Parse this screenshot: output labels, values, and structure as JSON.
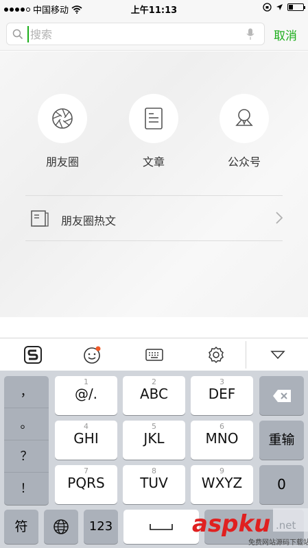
{
  "status_bar": {
    "carrier": "中国移动",
    "time": "上午11:13"
  },
  "search": {
    "placeholder": "搜索",
    "cancel_label": "取消"
  },
  "categories": [
    {
      "label": "朋友圈",
      "icon": "shutter-icon"
    },
    {
      "label": "文章",
      "icon": "document-icon"
    },
    {
      "label": "公众号",
      "icon": "person-icon"
    }
  ],
  "hot_row": {
    "label": "朋友圈热文"
  },
  "ime_toolbar": {
    "items": [
      "sogou-logo-icon",
      "emoji-icon",
      "keyboard-icon",
      "settings-gear-icon",
      "collapse-triangle-icon"
    ]
  },
  "keyboard": {
    "punctuation": [
      "，",
      "。",
      "？",
      "！"
    ],
    "keys": [
      {
        "num": "1",
        "label": "@/."
      },
      {
        "num": "2",
        "label": "ABC"
      },
      {
        "num": "3",
        "label": "DEF"
      },
      {
        "num": "4",
        "label": "GHI"
      },
      {
        "num": "5",
        "label": "JKL"
      },
      {
        "num": "6",
        "label": "MNO"
      },
      {
        "num": "7",
        "label": "PQRS"
      },
      {
        "num": "8",
        "label": "TUV"
      },
      {
        "num": "9",
        "label": "WXYZ"
      }
    ],
    "reenter_label": "重输",
    "zero_label": "0",
    "symbols_label": "符",
    "numbers_label": "123"
  },
  "watermark": {
    "brand": "aspku",
    "suffix": ".net",
    "caption": "免费网站源码下载站"
  },
  "colors": {
    "accent": "#1aad19",
    "brand_red": "#e02020"
  }
}
